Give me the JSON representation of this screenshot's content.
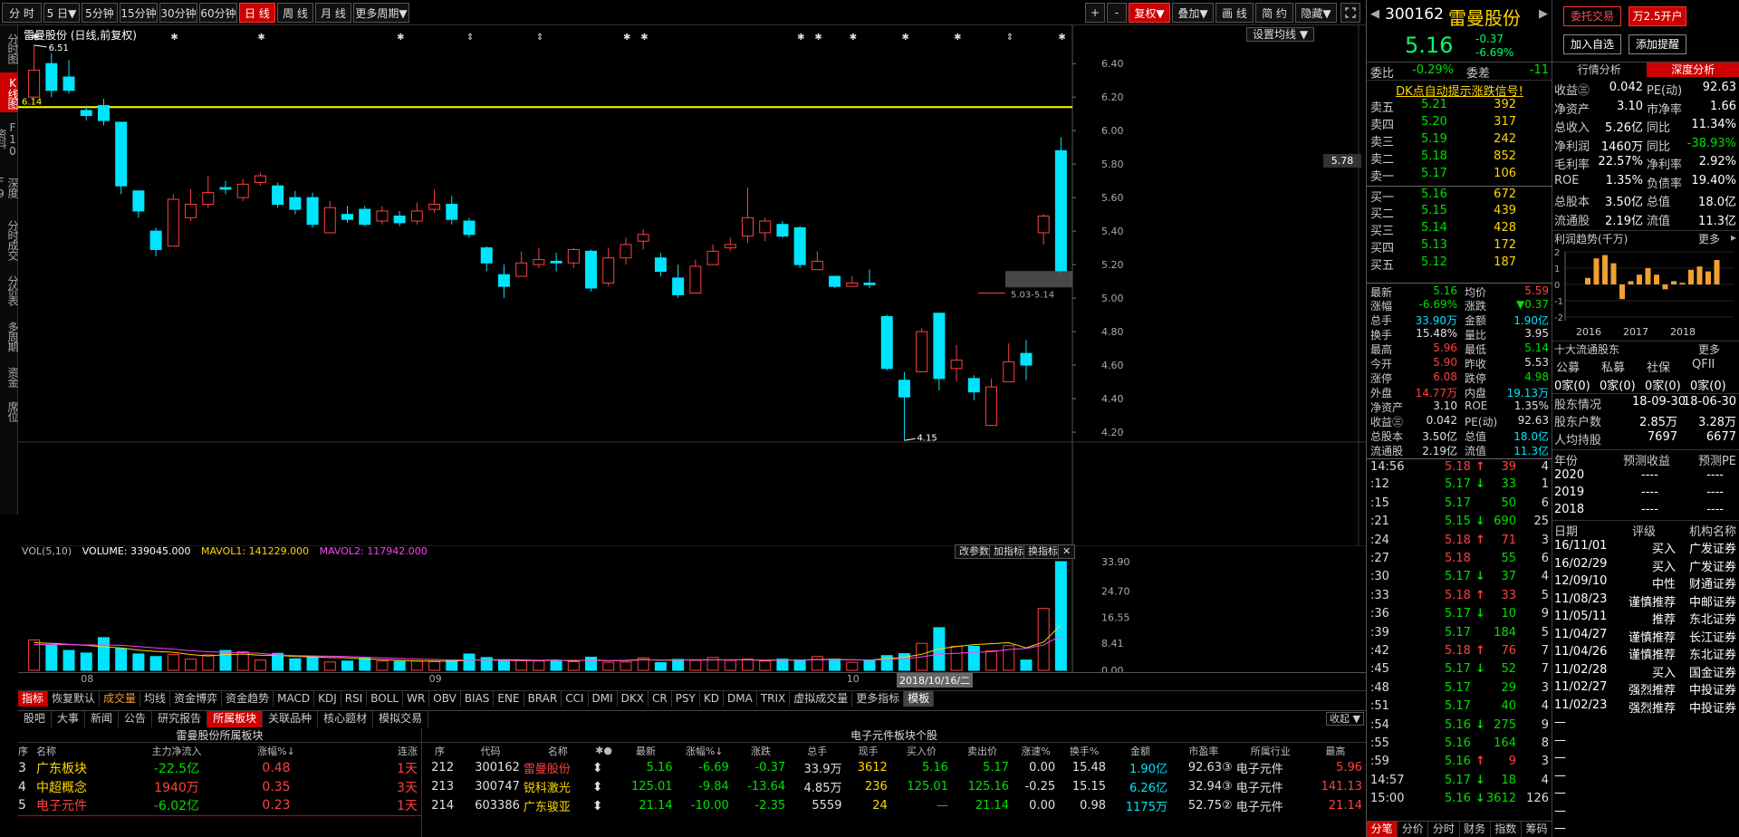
{
  "toolbar": {
    "periods": [
      "分 时",
      "5 日▼",
      "5分钟",
      "15分钟",
      "30分钟",
      "60分钟",
      "日 线",
      "周 线",
      "月 线",
      "更多周期▼"
    ],
    "active_period": 6,
    "right_buttons": [
      "+",
      "-",
      "复权▼",
      "叠加▼",
      "画 线",
      "简 约",
      "隐藏▼"
    ]
  },
  "leftnav": [
    "分时图",
    "K线图",
    "F10资料",
    "深度F9",
    "分时成交",
    "分价表",
    "多周期",
    "资金",
    "席位"
  ],
  "chart": {
    "header": "雷曼股份 (日线,前复权)",
    "setting_label": "设置均线 ▼",
    "price_axis": [
      "6.40",
      "6.20",
      "6.00",
      "5.80",
      "5.60",
      "5.40",
      "5.20",
      "5.00",
      "4.80",
      "4.60",
      "4.40",
      "4.20"
    ],
    "current_price_tag": "5.78",
    "annotations": {
      "high": "6.51",
      "low": "4.15",
      "hline": "6.14",
      "range": "5.03-5.14"
    },
    "candles": [
      [
        6.2,
        6.36,
        6.51,
        6.18
      ],
      [
        6.4,
        6.24,
        6.46,
        6.2
      ],
      [
        6.32,
        6.24,
        6.42,
        6.22
      ],
      [
        6.12,
        6.09,
        6.15,
        6.06
      ],
      [
        6.15,
        6.06,
        6.19,
        6.03
      ],
      [
        6.05,
        5.67,
        6.05,
        5.62
      ],
      [
        5.64,
        5.52,
        5.64,
        5.48
      ],
      [
        5.4,
        5.29,
        5.42,
        5.25
      ],
      [
        5.31,
        5.59,
        5.62,
        5.31
      ],
      [
        5.48,
        5.56,
        5.65,
        5.46
      ],
      [
        5.56,
        5.63,
        5.73,
        5.54
      ],
      [
        5.66,
        5.65,
        5.7,
        5.62
      ],
      [
        5.6,
        5.68,
        5.71,
        5.58
      ],
      [
        5.69,
        5.73,
        5.75,
        5.67
      ],
      [
        5.67,
        5.56,
        5.69,
        5.54
      ],
      [
        5.6,
        5.53,
        5.64,
        5.5
      ],
      [
        5.6,
        5.44,
        5.63,
        5.42
      ],
      [
        5.39,
        5.54,
        5.58,
        5.39
      ],
      [
        5.5,
        5.47,
        5.55,
        5.45
      ],
      [
        5.53,
        5.44,
        5.55,
        5.43
      ],
      [
        5.46,
        5.52,
        5.55,
        5.44
      ],
      [
        5.49,
        5.45,
        5.52,
        5.43
      ],
      [
        5.46,
        5.52,
        5.57,
        5.44
      ],
      [
        5.53,
        5.56,
        5.65,
        5.51
      ],
      [
        5.56,
        5.47,
        5.61,
        5.44
      ],
      [
        5.46,
        5.38,
        5.48,
        5.36
      ],
      [
        5.3,
        5.21,
        5.31,
        5.16
      ],
      [
        5.14,
        5.07,
        5.2,
        5.0
      ],
      [
        5.13,
        5.21,
        5.28,
        5.13
      ],
      [
        5.2,
        5.23,
        5.3,
        5.18
      ],
      [
        5.22,
        5.21,
        5.27,
        5.16
      ],
      [
        5.21,
        5.29,
        5.3,
        5.18
      ],
      [
        5.28,
        5.06,
        5.29,
        5.04
      ],
      [
        5.09,
        5.24,
        5.3,
        5.07
      ],
      [
        5.24,
        5.32,
        5.36,
        5.2
      ],
      [
        5.34,
        5.38,
        5.41,
        5.29
      ],
      [
        5.24,
        5.16,
        5.27,
        5.13
      ],
      [
        5.12,
        5.02,
        5.2,
        5.0
      ],
      [
        5.03,
        5.19,
        5.23,
        5.03
      ],
      [
        5.2,
        5.28,
        5.32,
        5.2
      ],
      [
        5.3,
        5.32,
        5.36,
        5.28
      ],
      [
        5.37,
        5.48,
        5.66,
        5.33
      ],
      [
        5.39,
        5.46,
        5.48,
        5.34
      ],
      [
        5.44,
        5.37,
        5.46,
        5.36
      ],
      [
        5.42,
        5.2,
        5.43,
        5.18
      ],
      [
        5.17,
        5.22,
        5.28,
        5.17
      ],
      [
        5.13,
        5.07,
        5.13,
        5.06
      ],
      [
        5.07,
        5.09,
        5.13,
        5.07
      ],
      [
        5.09,
        5.08,
        5.17,
        5.06
      ],
      [
        4.89,
        4.58,
        4.9,
        4.57
      ],
      [
        4.51,
        4.41,
        4.56,
        4.15
      ],
      [
        4.56,
        4.8,
        4.82,
        4.56
      ],
      [
        4.91,
        4.52,
        4.91,
        4.45
      ],
      [
        4.58,
        4.63,
        4.72,
        4.5
      ],
      [
        4.52,
        4.44,
        4.54,
        4.39
      ],
      [
        4.24,
        4.47,
        4.52,
        4.24
      ],
      [
        4.5,
        4.62,
        4.73,
        4.5
      ],
      [
        4.67,
        4.6,
        4.75,
        4.51
      ],
      [
        5.39,
        5.49,
        5.5,
        5.32
      ],
      [
        5.88,
        5.16,
        5.96,
        5.14
      ]
    ]
  },
  "volume": {
    "header": {
      "title": "VOL(5,10)",
      "volume": "VOLUME: 339045.000",
      "mavol1": "MAVOL1: 141229.000",
      "mavol2": "MAVOL2: 117942.000"
    },
    "axis": [
      "33.90",
      "24.70",
      "16.55",
      "8.41",
      "0.00"
    ],
    "buttons": [
      "改参数",
      "加指标",
      "换指标"
    ],
    "bars": [
      9.5,
      7.8,
      6.2,
      5.4,
      10.2,
      6.8,
      5.1,
      4.3,
      4.9,
      3.5,
      4.8,
      6.2,
      5.8,
      3.2,
      5.3,
      3.6,
      4.2,
      2.6,
      2.9,
      3.8,
      2.9,
      2.8,
      2.9,
      2.7,
      3.2,
      5.1,
      4.0,
      3.3,
      3.0,
      2.9,
      2.9,
      2.7,
      4.1,
      2.5,
      2.6,
      3.9,
      2.4,
      3.4,
      3.1,
      4.0,
      3.1,
      3.5,
      2.9,
      3.5,
      3.2,
      4.3,
      3.5,
      2.5,
      3.0,
      4.6,
      5.2,
      8.4,
      13.3,
      7.5,
      7.5,
      6.1,
      7.7,
      3.2,
      19.3,
      33.9
    ],
    "ma1": [
      8.6,
      8.4,
      8.1,
      7.8,
      7.3,
      7.0,
      6.3,
      5.9,
      5.6,
      4.9,
      4.5,
      4.9,
      5.1,
      4.7,
      4.7,
      4.3,
      4.2,
      4.0,
      3.9,
      3.6,
      3.3,
      3.1,
      2.9,
      2.9,
      2.8,
      3.2,
      3.3,
      3.3,
      3.2,
      3.1,
      3.2,
      2.9,
      3.3,
      3.0,
      3.1,
      3.4,
      3.1,
      3.2,
      3.3,
      3.3,
      3.3,
      3.3,
      3.1,
      3.2,
      3.2,
      3.4,
      3.4,
      3.3,
      3.2,
      3.6,
      4.1,
      5.0,
      6.7,
      7.4,
      8.0,
      8.3,
      8.6,
      7.0,
      8.8,
      14.2
    ],
    "ma2": [
      8.0,
      8.0,
      8.0,
      7.9,
      7.9,
      7.8,
      7.4,
      7.0,
      6.6,
      6.1,
      5.8,
      5.6,
      5.5,
      5.3,
      4.8,
      4.6,
      4.5,
      4.4,
      4.3,
      4.1,
      3.9,
      3.7,
      3.5,
      3.4,
      3.2,
      3.2,
      3.2,
      3.1,
      3.0,
      3.0,
      3.1,
      3.1,
      3.1,
      3.0,
      3.0,
      3.3,
      3.2,
      3.2,
      3.2,
      3.2,
      3.3,
      3.2,
      3.2,
      3.2,
      3.2,
      3.3,
      3.3,
      3.3,
      3.2,
      3.3,
      3.6,
      4.2,
      5.0,
      5.3,
      5.6,
      5.8,
      6.5,
      6.8,
      7.9,
      10.8
    ]
  },
  "xaxis": {
    "ticks": [
      {
        "label": "08",
        "i": 3
      },
      {
        "label": "09",
        "i": 23
      },
      {
        "label": "10",
        "i": 47
      }
    ],
    "date_tag": "2018/10/16/二"
  },
  "indicator_tabs": [
    "指标",
    "恢复默认",
    "成交量",
    "均线",
    "资金博弈",
    "资金趋势",
    "MACD",
    "KDJ",
    "RSI",
    "BOLL",
    "WR",
    "OBV",
    "BIAS",
    "ENE",
    "BRAR",
    "CCI",
    "DMI",
    "DKX",
    "CR",
    "PSY",
    "KD",
    "DMA",
    "TRIX",
    "虚拟成交量",
    "更多指标",
    "模板"
  ],
  "bottom_tabs": [
    "股吧",
    "大事",
    "新闻",
    "公告",
    "研究报告",
    "所属板块",
    "关联品种",
    "核心题材",
    "模拟交易"
  ],
  "bottom_shouqi": "收起 ▼",
  "sector_panel": {
    "title": "雷曼股份所属板块",
    "headers": [
      "序",
      "名称",
      "主力净流入",
      "涨幅%↓",
      "连涨"
    ],
    "rows": [
      {
        "no": "3",
        "name": "广东板块",
        "flow": "-22.5亿",
        "pct": "0.48",
        "streak": "1天"
      },
      {
        "no": "4",
        "name": "中超概念",
        "flow": "1940万",
        "pct": "0.35",
        "streak": "3天"
      },
      {
        "no": "5",
        "name": "电子元件",
        "flow": "-6.02亿",
        "pct": "0.23",
        "streak": "1天"
      }
    ]
  },
  "stocks_panel": {
    "title": "电子元件板块个股",
    "headers": [
      "序",
      "代码",
      "名称",
      "✱●",
      "最新",
      "涨幅%↓",
      "涨跌",
      "总手",
      "现手",
      "买入价",
      "卖出价",
      "涨速%",
      "换手%",
      "金额",
      "市盈率",
      "所属行业",
      "最高"
    ],
    "rows": [
      {
        "no": "212",
        "code": "300162",
        "name": "雷曼股份",
        "last": "5.16",
        "pct": "-6.69",
        "chg": "-0.37",
        "vol": "33.9万",
        "cur": "3612",
        "bid": "5.16",
        "ask": "5.17",
        "speed": "0.00",
        "turn": "15.48",
        "amt": "1.90亿",
        "pe": "92.63③",
        "ind": "电子元件",
        "high": "5.96"
      },
      {
        "no": "213",
        "code": "300747",
        "name": "锐科激光",
        "last": "125.01",
        "pct": "-9.84",
        "chg": "-13.64",
        "vol": "4.85万",
        "cur": "236",
        "bid": "125.01",
        "ask": "125.16",
        "speed": "-0.25",
        "turn": "15.15",
        "amt": "6.26亿",
        "pe": "32.94③",
        "ind": "电子元件",
        "high": "141.13"
      },
      {
        "no": "214",
        "code": "603386",
        "name": "广东骏亚",
        "last": "21.14",
        "pct": "-10.00",
        "chg": "-2.35",
        "vol": "5559",
        "cur": "24",
        "bid": "—",
        "ask": "21.14",
        "speed": "0.00",
        "turn": "0.98",
        "amt": "1175万",
        "pe": "52.75②",
        "ind": "电子元件",
        "high": "21.14"
      }
    ]
  },
  "quote": {
    "code": "300162",
    "name": "雷曼股份",
    "price": "5.16",
    "chg": "-0.37",
    "pct": "-6.69%",
    "weibi_label": "委比",
    "weibi": "-0.29%",
    "weicha_label": "委差",
    "weicha": "-11",
    "dk_signal": "DK点自动提示涨跌信号!",
    "asks": [
      {
        "label": "卖五",
        "price": "5.21",
        "vol": "392"
      },
      {
        "label": "卖四",
        "price": "5.20",
        "vol": "317"
      },
      {
        "label": "卖三",
        "price": "5.19",
        "vol": "242"
      },
      {
        "label": "卖二",
        "price": "5.18",
        "vol": "852"
      },
      {
        "label": "卖一",
        "price": "5.17",
        "vol": "106"
      }
    ],
    "bids": [
      {
        "label": "买一",
        "price": "5.16",
        "vol": "672"
      },
      {
        "label": "买二",
        "price": "5.15",
        "vol": "439"
      },
      {
        "label": "买三",
        "price": "5.14",
        "vol": "428"
      },
      {
        "label": "买四",
        "price": "5.13",
        "vol": "172"
      },
      {
        "label": "买五",
        "price": "5.12",
        "vol": "187"
      }
    ],
    "stats": [
      [
        "最新",
        "5.16",
        "均价",
        "5.59"
      ],
      [
        "涨幅",
        "-6.69%",
        "涨跌",
        "▼0.37"
      ],
      [
        "总手",
        "33.90万",
        "金额",
        "1.90亿"
      ],
      [
        "换手",
        "15.48%",
        "量比",
        "3.95"
      ],
      [
        "最高",
        "5.96",
        "最低",
        "5.14"
      ],
      [
        "今开",
        "5.90",
        "昨收",
        "5.53"
      ],
      [
        "涨停",
        "6.08",
        "跌停",
        "4.98"
      ],
      [
        "外盘",
        "14.77万",
        "内盘",
        "19.13万"
      ],
      [
        "净资产",
        "3.10",
        "ROE",
        "1.35%"
      ],
      [
        "收益㊂",
        "0.042",
        "PE(动)",
        "92.63"
      ],
      [
        "总股本",
        "3.50亿",
        "总值",
        "18.0亿"
      ],
      [
        "流通股",
        "2.19亿",
        "流值",
        "11.3亿"
      ]
    ],
    "ticks": [
      {
        "t": "14:56",
        "p": "5.18",
        "a": "↑",
        "v": "39",
        "n": "4"
      },
      {
        "t": ":12",
        "p": "5.17",
        "a": "↓",
        "v": "33",
        "n": "1"
      },
      {
        "t": ":15",
        "p": "5.17",
        "a": "",
        "v": "50",
        "n": "6"
      },
      {
        "t": ":21",
        "p": "5.15",
        "a": "↓",
        "v": "690",
        "n": "25"
      },
      {
        "t": ":24",
        "p": "5.18",
        "a": "↑",
        "v": "71",
        "n": "3"
      },
      {
        "t": ":27",
        "p": "5.18",
        "a": "",
        "v": "55",
        "n": "6"
      },
      {
        "t": ":30",
        "p": "5.17",
        "a": "↓",
        "v": "37",
        "n": "4"
      },
      {
        "t": ":33",
        "p": "5.18",
        "a": "↑",
        "v": "33",
        "n": "5"
      },
      {
        "t": ":36",
        "p": "5.17",
        "a": "↓",
        "v": "10",
        "n": "9"
      },
      {
        "t": ":39",
        "p": "5.17",
        "a": "",
        "v": "184",
        "n": "5"
      },
      {
        "t": ":42",
        "p": "5.18",
        "a": "↑",
        "v": "76",
        "n": "7"
      },
      {
        "t": ":45",
        "p": "5.17",
        "a": "↓",
        "v": "52",
        "n": "7"
      },
      {
        "t": ":48",
        "p": "5.17",
        "a": "",
        "v": "29",
        "n": "3"
      },
      {
        "t": ":51",
        "p": "5.17",
        "a": "",
        "v": "40",
        "n": "4"
      },
      {
        "t": ":54",
        "p": "5.16",
        "a": "↓",
        "v": "275",
        "n": "9"
      },
      {
        "t": ":55",
        "p": "5.16",
        "a": "",
        "v": "164",
        "n": "8"
      },
      {
        "t": ":59",
        "p": "5.16",
        "a": "↑",
        "v": "9",
        "n": "3"
      },
      {
        "t": "14:57",
        "p": "5.17",
        "a": "↓",
        "v": "18",
        "n": "4"
      },
      {
        "t": "15:00",
        "p": "5.16",
        "a": "↓",
        "v": "3612",
        "n": "126"
      }
    ],
    "sub_tabs": [
      "分笔",
      "分价",
      "分时",
      "财务",
      "指数",
      "筹码"
    ]
  },
  "deep": {
    "buttons": [
      "委托交易",
      "万2.5开户",
      "加入自选",
      "添加提醒"
    ],
    "tabs": [
      "行情分析",
      "深度分析"
    ],
    "fin": [
      [
        "收益㊂",
        "0.042",
        "PE(动)",
        "92.63"
      ],
      [
        "净资产",
        "3.10",
        "市净率",
        "1.66"
      ],
      [
        "总收入",
        "5.26亿",
        "同比",
        "11.34%"
      ],
      [
        "净利润",
        "1460万",
        "同比",
        "-38.93%"
      ],
      [
        "毛利率",
        "22.57%",
        "净利率",
        "2.92%"
      ],
      [
        "ROE",
        "1.35%",
        "负债率",
        "19.40%"
      ],
      [
        "总股本",
        "3.50亿",
        "总值",
        "18.0亿"
      ],
      [
        "流通股",
        "2.19亿",
        "流值",
        "11.3亿"
      ]
    ],
    "profit_title": "利润趋势(千万)",
    "more": "更多",
    "profit_axis": [
      "2",
      "1",
      "0",
      "-1",
      "-2"
    ],
    "profit_years": [
      "2016",
      "2017",
      "2018"
    ],
    "profit_bars": [
      0.4,
      1.6,
      1.8,
      1.3,
      -0.9,
      0.2,
      0.6,
      1.0,
      0.6,
      -0.3,
      0.2,
      0.1,
      0.9,
      1.1,
      0.8,
      1.5
    ],
    "holders_title": "十大流通股东",
    "holder_types": [
      "公募",
      "私募",
      "社保",
      "QFII"
    ],
    "holder_vals": [
      "0家(0)",
      "0家(0)",
      "0家(0)",
      "0家(0)"
    ],
    "holder_info": [
      [
        "股东情况",
        "18-09-30",
        "18-06-30"
      ],
      [
        "股东户数",
        "2.85万",
        "3.28万"
      ],
      [
        "人均持股",
        "7697",
        "6677"
      ]
    ],
    "forecast_headers": [
      "年份",
      "预测收益",
      "预测PE"
    ],
    "forecast_rows": [
      [
        "2020",
        "----",
        "----"
      ],
      [
        "2019",
        "----",
        "----"
      ],
      [
        "2018",
        "----",
        "----"
      ]
    ],
    "rating_headers": [
      "日期",
      "评级",
      "机构名称"
    ],
    "ratings": [
      [
        "16/11/01",
        "买入",
        "广发证券"
      ],
      [
        "16/02/29",
        "买入",
        "广发证券"
      ],
      [
        "12/09/10",
        "中性",
        "财通证券"
      ],
      [
        "11/08/23",
        "谨慎推荐",
        "中邮证券"
      ],
      [
        "11/05/11",
        "推荐",
        "东北证券"
      ],
      [
        "11/04/27",
        "谨慎推荐",
        "长江证券"
      ],
      [
        "11/04/26",
        "谨慎推荐",
        "东北证券"
      ],
      [
        "11/02/28",
        "买入",
        "国金证券"
      ],
      [
        "11/02/27",
        "强烈推荐",
        "中投证券"
      ],
      [
        "11/02/23",
        "强烈推荐",
        "中投证券"
      ],
      [
        "—",
        "",
        ""
      ],
      [
        "—",
        "",
        ""
      ],
      [
        "—",
        "",
        ""
      ],
      [
        "—",
        "",
        ""
      ],
      [
        "—",
        "",
        ""
      ],
      [
        "—",
        "",
        ""
      ],
      [
        "—",
        "",
        ""
      ]
    ]
  },
  "colors": {
    "up": "#ff4040",
    "down": "#00e5ff",
    "ma1": "#ffd700",
    "ma2": "#ff40ff",
    "hline": "#ffff00"
  }
}
